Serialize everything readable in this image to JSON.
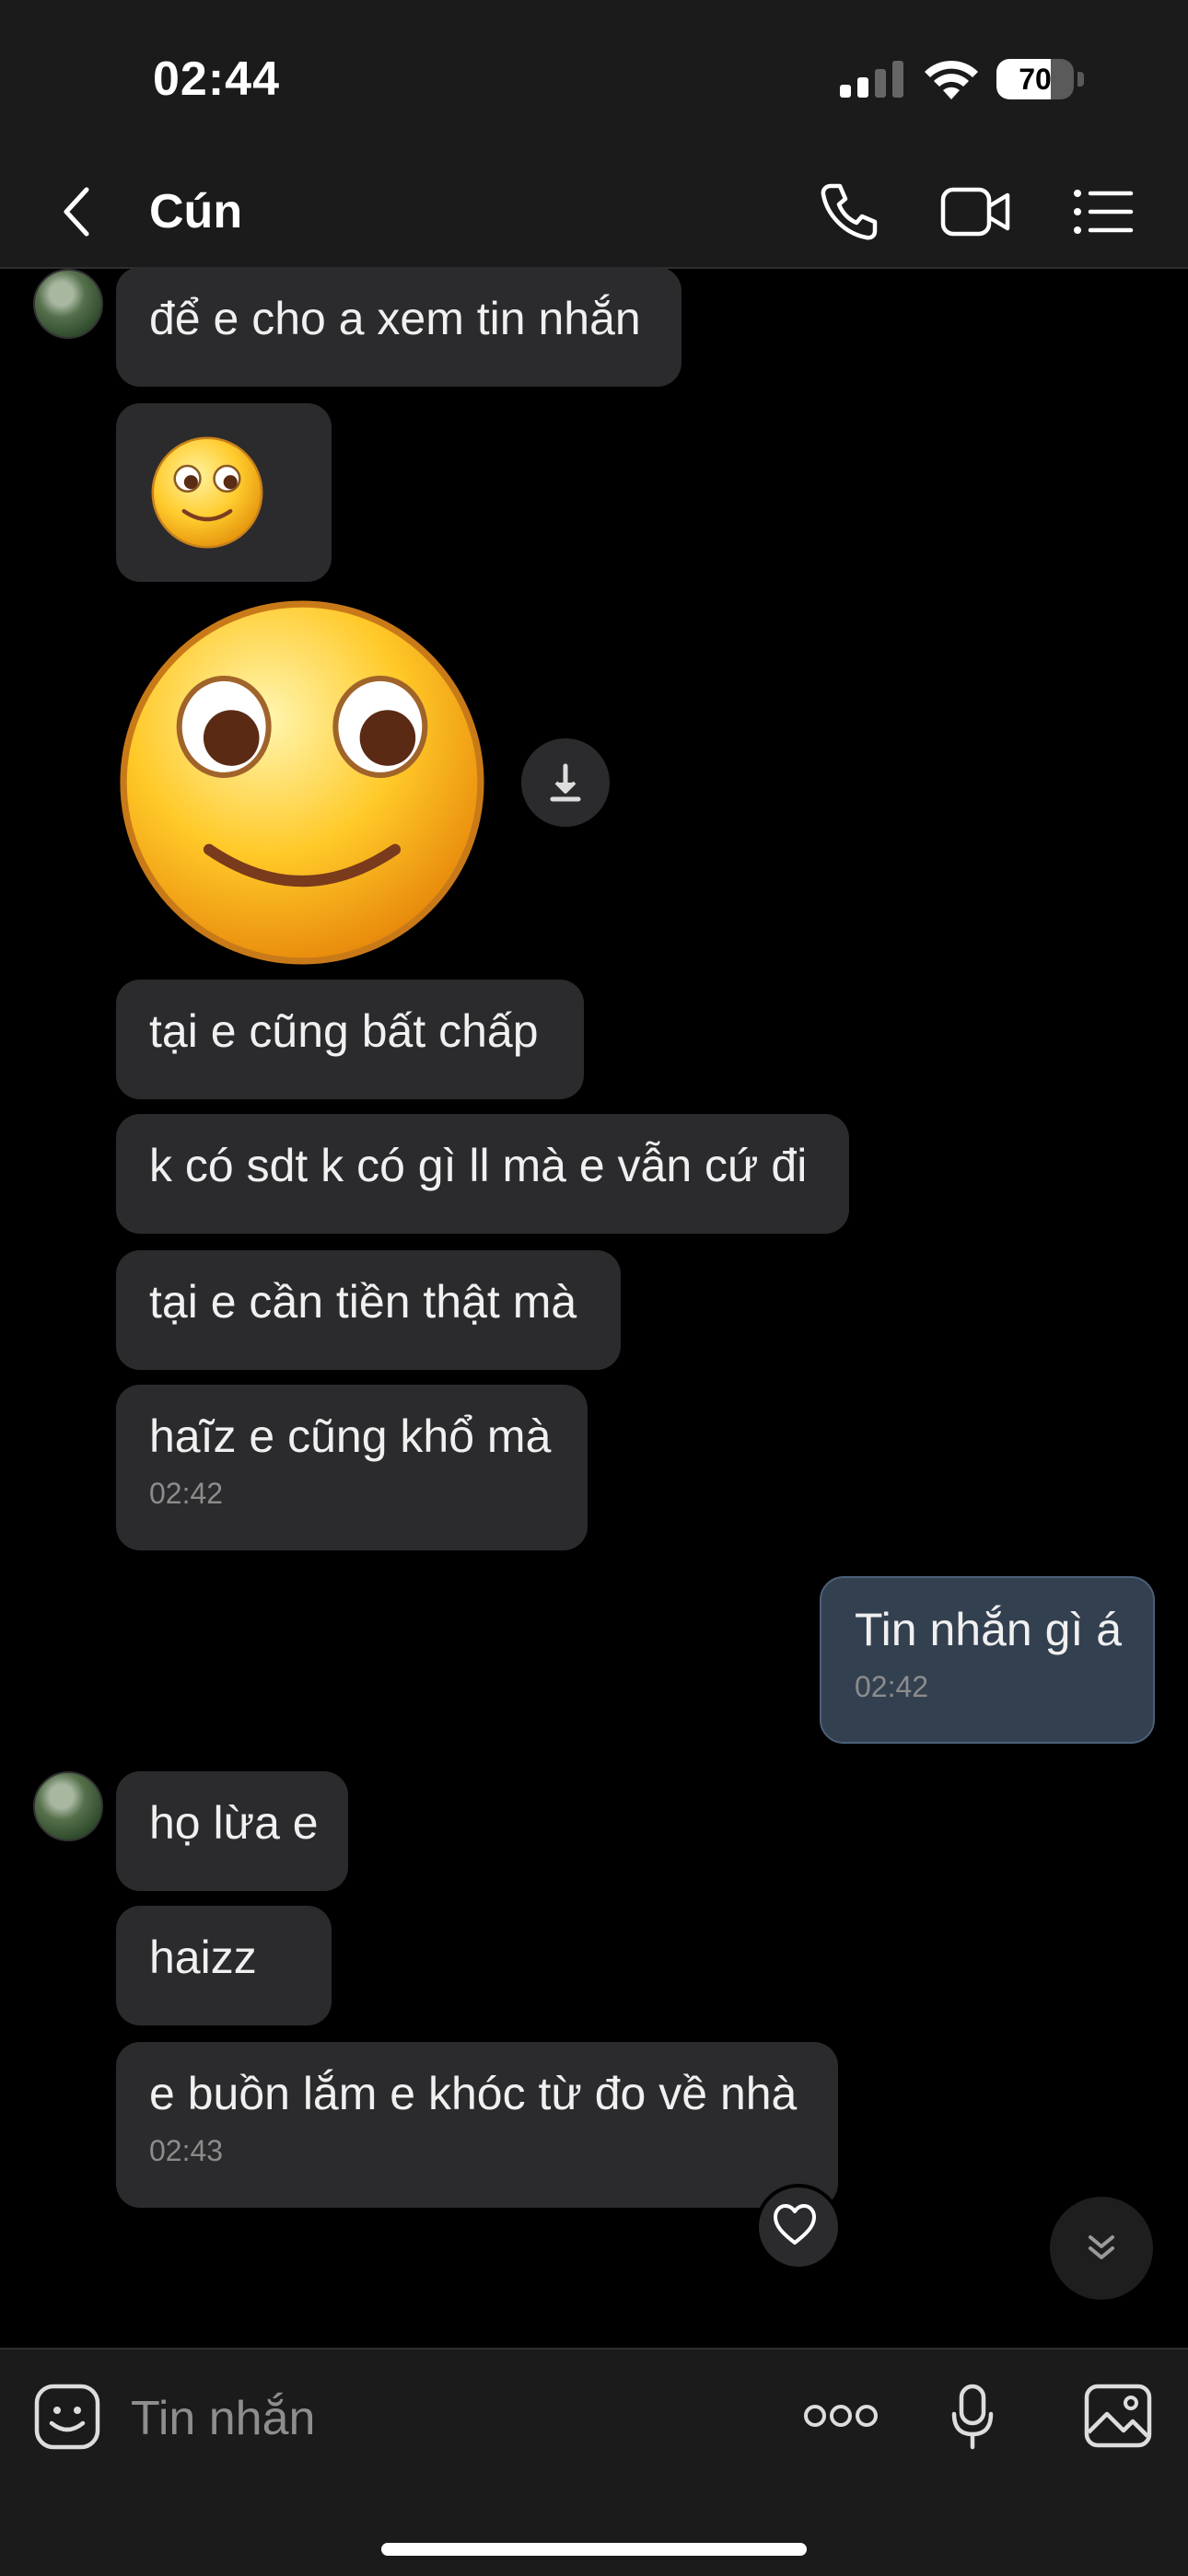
{
  "status_bar": {
    "time": "02:44",
    "battery": "70",
    "battery_level": 0.7
  },
  "header": {
    "contact_name": "Cún"
  },
  "messages": [
    {
      "text": "để e cho a xem tin nhắn"
    },
    {
      "emoji": "slightly-smiling-face"
    },
    {
      "emoji": "slightly-smiling-face-large"
    },
    {
      "text": "tại e cũng bất chấp"
    },
    {
      "text": "k có sdt k có gì ll mà e vẫn cứ đi"
    },
    {
      "text": "tại e cần tiền thật mà"
    },
    {
      "text": "haĩz e cũng khổ mà",
      "time": "02:42"
    },
    {
      "text": "Tin nhắn gì á",
      "time": "02:42",
      "outgoing": true
    },
    {
      "text": "họ lừa e"
    },
    {
      "text": "haizz"
    },
    {
      "text": "e buồn lắm e khóc từ đo về nhà",
      "time": "02:43",
      "reaction": "heart"
    }
  ],
  "input": {
    "placeholder": "Tin nhắn"
  },
  "colors": {
    "incoming_bubble": "#2b2b2d",
    "outgoing_bubble": "#334050",
    "background": "#000000"
  }
}
